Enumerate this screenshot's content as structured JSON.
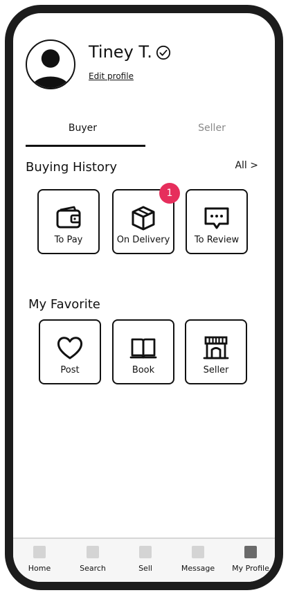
{
  "profile": {
    "name": "Tiney T.",
    "edit_label": "Edit profile"
  },
  "tabs": {
    "buyer": "Buyer",
    "seller": "Seller"
  },
  "buying_history": {
    "title": "Buying History",
    "see_all": "All >",
    "items": [
      {
        "label": "To Pay",
        "icon": "wallet-icon"
      },
      {
        "label": "On Delivery",
        "icon": "package-icon",
        "badge": "1"
      },
      {
        "label": "To Review",
        "icon": "message-icon"
      }
    ]
  },
  "favorites": {
    "title": "My Favorite",
    "items": [
      {
        "label": "Post",
        "icon": "heart-icon"
      },
      {
        "label": "Book",
        "icon": "book-icon"
      },
      {
        "label": "Seller",
        "icon": "store-icon"
      }
    ]
  },
  "nav": {
    "items": [
      {
        "label": "Home"
      },
      {
        "label": "Search"
      },
      {
        "label": "Sell"
      },
      {
        "label": "Message"
      },
      {
        "label": "My Profile",
        "active": true
      }
    ]
  },
  "colors": {
    "badge": "#e62e5c",
    "frame": "#1c1c1c",
    "nav_active": "#6a6a6a",
    "nav_inactive": "#d4d4d4"
  }
}
